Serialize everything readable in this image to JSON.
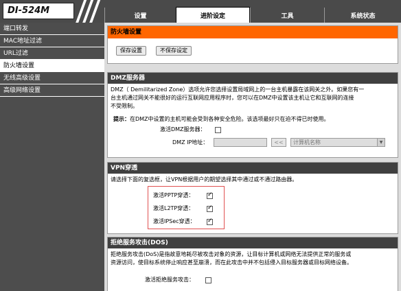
{
  "brand": {
    "logo": "DI-524M"
  },
  "tabs": [
    {
      "label": "设置"
    },
    {
      "label": "进阶设定"
    },
    {
      "label": "工具"
    },
    {
      "label": "系统状态"
    }
  ],
  "sidebar": {
    "items": [
      {
        "label": "端口转发"
      },
      {
        "label": "MAC地址过滤"
      },
      {
        "label": "URL过滤"
      },
      {
        "label": "防火墙设置"
      },
      {
        "label": "无线高级设置"
      },
      {
        "label": "高级网络设置"
      }
    ]
  },
  "firewall": {
    "title": "防火墙设置",
    "save_label": "保存设置",
    "nosave_label": "不保存设定"
  },
  "dmz": {
    "title": "DMZ服务器",
    "desc1": "DMZ（ Demilitarized Zone）选项允许您选择设置局域网上的一台主机暴露在该网关之外。如果您有一",
    "desc2": "台主机通过网关不能很好的运行互联网应用程序时，您可以在DMZ中设置该主机让它和互联网的连接",
    "desc3": "不受限制。",
    "tip_label": "提示：",
    "tip_text": "在DMZ中设置的主机可能会受到各种安全危险。该选项最好只在迫不得已时使用。",
    "enable_label": "激活DMZ服务器：",
    "ip_label": "DMZ IP地址：",
    "arrow_label": "<<",
    "computer_name_placeholder": "计算机名称"
  },
  "vpn": {
    "title": "VPN穿透",
    "desc": "请选择下面的复选框，让VPN根据用户的期望选择其中通过或不通过路由器。",
    "pptp_label": "激活PPTP穿透：",
    "l2tp_label": "激活L2TP穿透：",
    "ipsec_label": "激活IPSec穿透：",
    "pptp_checked": true,
    "l2tp_checked": true,
    "ipsec_checked": true
  },
  "dos": {
    "title": "拒绝服务攻击(DOS)",
    "desc1": "拒绝服务攻击(DoS)是指故意地耗尽被攻击对象的资源，让目标计算机或网络无法提供正常的服务或",
    "desc2": "资源访问，使目标系统停止响应甚至崩溃，而在此攻击中并不包括侵入目标服务器或目标网络设备。",
    "enable_label": "激活拒绝服务攻击：",
    "checked": false
  },
  "colors": {
    "topbar": "#4a4a4a",
    "sidebar": "#4d4d4d",
    "section_header": "#404040",
    "accent_orange": "#ff6600",
    "highlight_red": "#e05050"
  }
}
